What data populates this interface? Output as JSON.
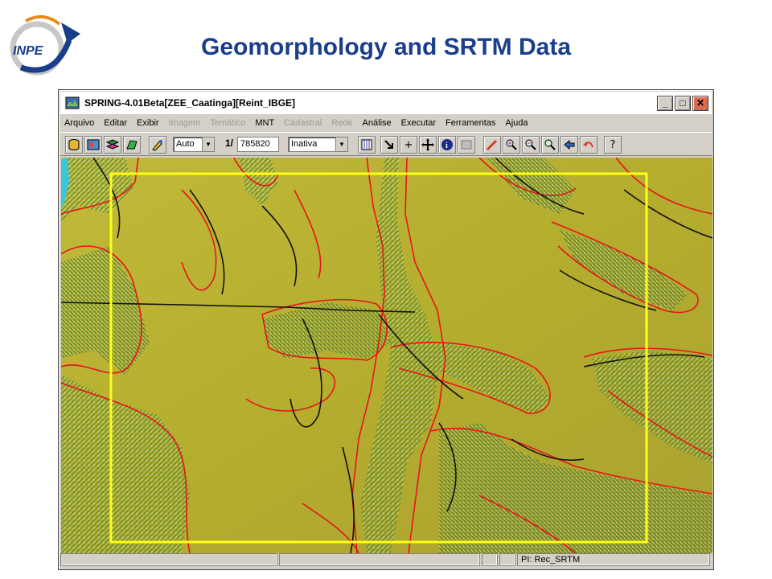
{
  "slide": {
    "title": "Geomorphology and SRTM Data",
    "logo_text": "INPE"
  },
  "window": {
    "title": "SPRING-4.01Beta[ZEE_Caatinga][Reint_IBGE]",
    "buttons": {
      "minimize": "_",
      "maximize": "□",
      "close": "✕"
    }
  },
  "menu": {
    "items": [
      {
        "label": "Arquivo",
        "enabled": true
      },
      {
        "label": "Editar",
        "enabled": true
      },
      {
        "label": "Exibir",
        "enabled": true
      },
      {
        "label": "Imagem",
        "enabled": false
      },
      {
        "label": "Temático",
        "enabled": false
      },
      {
        "label": "MNT",
        "enabled": true
      },
      {
        "label": "Cadastral",
        "enabled": false
      },
      {
        "label": "Rede",
        "enabled": false
      },
      {
        "label": "Análise",
        "enabled": true
      },
      {
        "label": "Executar",
        "enabled": true
      },
      {
        "label": "Ferramentas",
        "enabled": true
      },
      {
        "label": "Ajuda",
        "enabled": true
      }
    ]
  },
  "toolbar": {
    "zoom_mode": "Auto",
    "scale_prefix": "1/",
    "scale_value": "785820",
    "mode_select": "Inativa",
    "help_glyph": "?"
  },
  "status": {
    "plan_label": "PI: Rec_SRTM"
  },
  "colors": {
    "terrain_base": "#b9b332",
    "contour_red": "#e8141a",
    "contour_black": "#111111",
    "roi_yellow": "#ffff1a",
    "title_blue": "#1a3e8a"
  }
}
